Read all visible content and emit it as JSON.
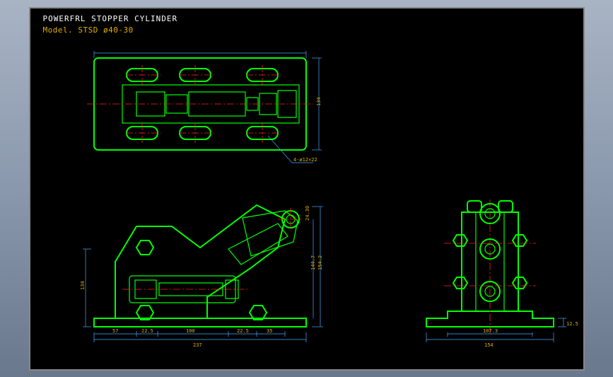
{
  "header": {
    "title": "POWERFRL STOPPER CYLINDER",
    "model_prefix": "Model.",
    "model_code": "STSD ø40-30"
  },
  "dims": {
    "slot_note": "4-ø12×22",
    "top_width": "134",
    "front": [
      "57",
      "22.5",
      "100",
      "22.5",
      "35"
    ],
    "front_total": "237",
    "front_h1": "154.2",
    "front_h2": "144.7",
    "front_h3": "24.30",
    "front_left": "134",
    "end_inner": "107.3",
    "end_total": "154",
    "end_foot": "12.5"
  },
  "views": {
    "top": {
      "type": "plan",
      "slots": 6
    },
    "front": {
      "type": "elevation"
    },
    "end": {
      "type": "section"
    }
  },
  "colors": {
    "geometry": "#00ff00",
    "centerline": "#ff2020",
    "dimension": "#4488ff",
    "annotation": "#e0b000",
    "canvas": "#000000"
  }
}
